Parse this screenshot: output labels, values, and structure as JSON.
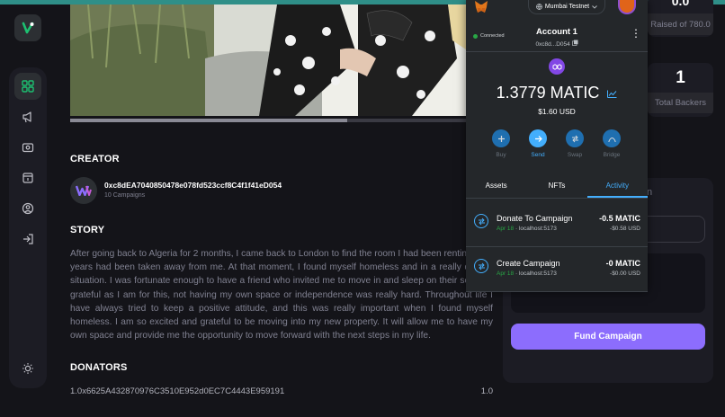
{
  "colors": {
    "accent": "#8c6dfd",
    "brand": "#1dc071",
    "metamask_link": "#43aefc",
    "connected": "#28a745"
  },
  "header": {
    "raised_label": "Raised of 780.0",
    "top_value_partial": "0.0"
  },
  "stats": {
    "backers_value": "1",
    "backers_label": "Total Backers"
  },
  "campaign": {
    "progress_fraction": 0.7
  },
  "creator": {
    "title": "CREATOR",
    "address": "0xc8dEA7040850478e078fd523ccf8C4f1f41eD054",
    "campaigns": "10 Campaigns"
  },
  "story": {
    "title": "STORY",
    "text": "After going back to Algeria for 2 months, I came back to London to find the room I had been renting for 2 years had been taken away from me. At that moment, I found myself homeless and in a really difficult situation. I was fortunate enough to have a friend who invited me to move in and sleep on their sofa. As grateful as I am for this, not having my own space or independence was really hard. Throughout life I have always tried to keep a positive attitude, and this was really important when I found myself homeless. I am so excited and grateful to be moving into my new property. It will allow me to have my own space and provide me the opportunity to move forward with the next steps in my life."
  },
  "donators": {
    "title": "DONATORS",
    "rows": [
      {
        "address": "1.0x6625A432870976C3510E952d0EC7C4443E959191",
        "amount": "1.0"
      }
    ]
  },
  "fund": {
    "title_partial": "n",
    "info_text": "d, just because it speaks to you.",
    "button_label": "Fund Campaign"
  },
  "metamask": {
    "network": "Mumbai Testnet",
    "connected_label": "Connected",
    "account_name": "Account 1",
    "account_address": "0xc8d...D054",
    "balance": "1.3779 MATIC",
    "balance_usd": "$1.60 USD",
    "actions": [
      "Buy",
      "Send",
      "Swap",
      "Bridge"
    ],
    "tabs": [
      "Assets",
      "NFTs",
      "Activity"
    ],
    "transactions": [
      {
        "title": "Donate To Campaign",
        "date": "Apr 18",
        "origin": "localhost:5173",
        "amount": "-0.5 MATIC",
        "usd": "-$0.58 USD"
      },
      {
        "title": "Create Campaign",
        "date": "Apr 18",
        "origin": "localhost:5173",
        "amount": "-0 MATIC",
        "usd": "-$0.00 USD"
      }
    ]
  }
}
